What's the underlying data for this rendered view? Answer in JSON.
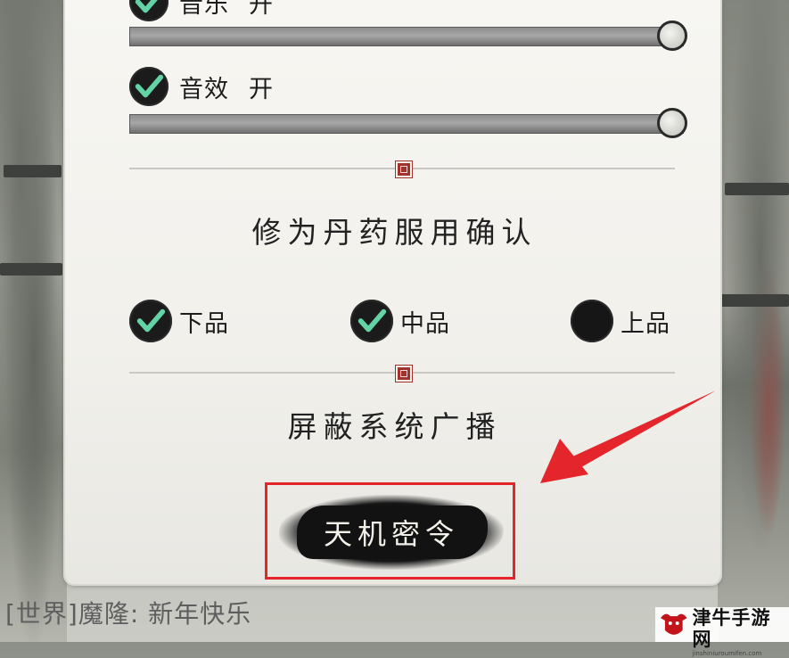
{
  "settings": {
    "music": {
      "label": "音乐",
      "state": "开",
      "checked": true,
      "volume_percent": 100
    },
    "sfx": {
      "label": "音效",
      "state": "开",
      "checked": true,
      "volume_percent": 100
    }
  },
  "pill_confirm": {
    "title": "修为丹药服用确认",
    "options": [
      {
        "label": "下品",
        "checked": true
      },
      {
        "label": "中品",
        "checked": true
      },
      {
        "label": "上品",
        "checked": false
      }
    ]
  },
  "broadcast": {
    "title": "屏蔽系统广播"
  },
  "secret_button": {
    "label": "天机密令"
  },
  "chat": {
    "message": "[世界]魔隆:  新年快乐"
  },
  "watermark": {
    "name": "津牛手游网",
    "url": "jinshiniuroumifen.com"
  },
  "colors": {
    "check_mark": "#63d3a6",
    "highlight": "#e4262c",
    "seal": "#a2322c"
  }
}
